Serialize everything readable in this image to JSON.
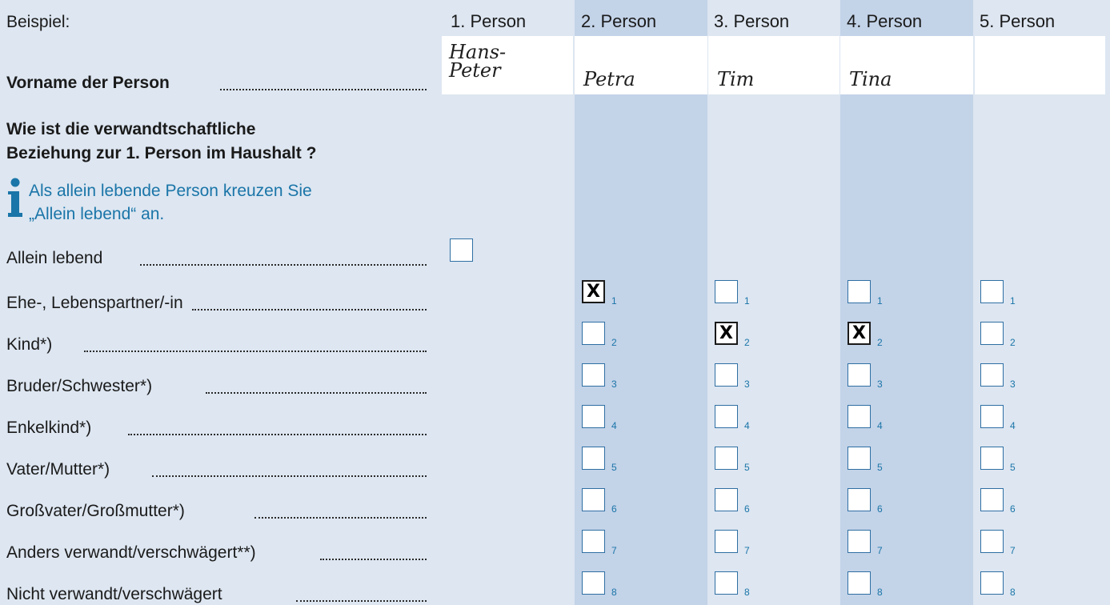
{
  "example_label": "Beispiel:",
  "columns": [
    "1. Person",
    "2. Person",
    "3. Person",
    "4. Person",
    "5. Person"
  ],
  "names": {
    "p1_line1": "Hans-",
    "p1_line2": "Peter",
    "p2": "Petra",
    "p3": "Tim",
    "p4": "Tina"
  },
  "first_name_label": "Vorname der Person",
  "question_line1": "Wie ist die verwandtschaftliche",
  "question_line2": "Beziehung zur 1. Person im Haushalt ?",
  "info_line1": "Als allein lebende Person kreuzen Sie",
  "info_line2": "„Allein lebend“ an.",
  "alone_label": "Allein lebend",
  "relationships": [
    {
      "label": "Ehe-, Lebenspartner/-in",
      "code": "1"
    },
    {
      "label": "Kind*)",
      "code": "2"
    },
    {
      "label": "Bruder/Schwester*)",
      "code": "3"
    },
    {
      "label": "Enkelkind*)",
      "code": "4"
    },
    {
      "label": "Vater/Mutter*)",
      "code": "5"
    },
    {
      "label": "Großvater/Großmutter*)",
      "code": "6"
    },
    {
      "label": "Anders verwandt/verschwägert**)",
      "code": "7"
    },
    {
      "label": "Nicht verwandt/verschwägert",
      "code": "8"
    }
  ],
  "checks": {
    "person2": 1,
    "person3": 2,
    "person4": 2
  },
  "check_mark": "X",
  "colors": {
    "background": "#dde6f1",
    "stripe": "#c3d3e8",
    "info": "#1a75a8"
  }
}
